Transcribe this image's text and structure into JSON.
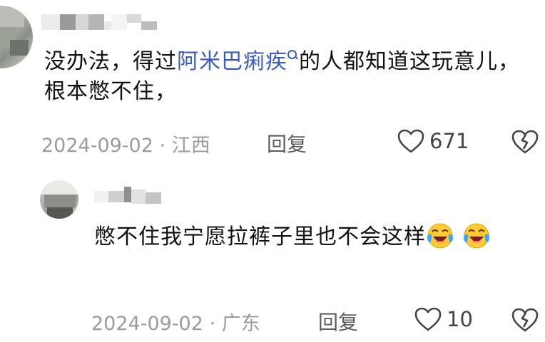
{
  "comments": [
    {
      "text_before": "没办法，得过",
      "link_text": "阿米巴痢疾",
      "text_after": "的人都知道这玩意儿，根本憋不住，",
      "date": "2024-09-02",
      "separator": "·",
      "location": "江西",
      "reply_label": "回复",
      "likes": "671"
    },
    {
      "text": "憋不住我宁愿拉裤子里也不会这样",
      "emoji_icon": "laughing-crying-emoji",
      "date": "2024-09-02",
      "separator": "·",
      "location": "广东",
      "reply_label": "回复",
      "likes": "10"
    }
  ],
  "colors": {
    "link": "#3a5bbf",
    "meta": "#9b9b9b",
    "text": "#111111"
  }
}
